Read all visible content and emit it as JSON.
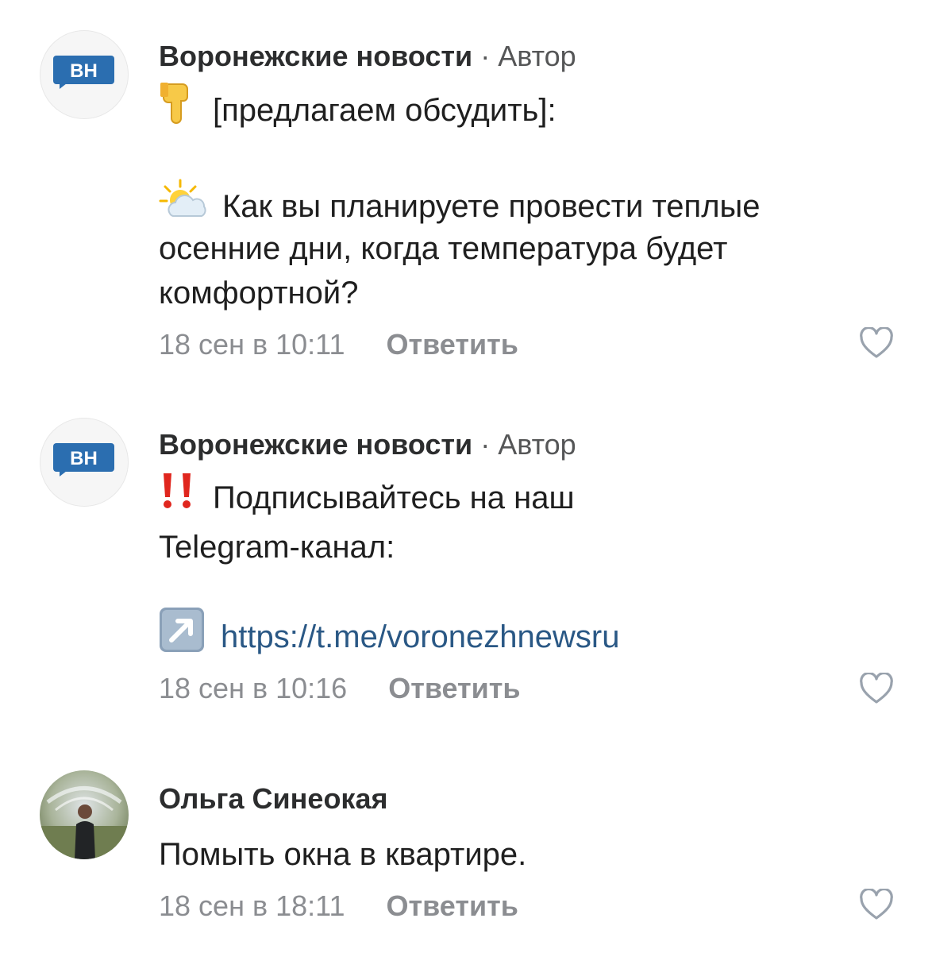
{
  "comments": [
    {
      "author": "Воронежские новости",
      "separator": "·",
      "role": "Автор",
      "avatar_text": "ВН",
      "line1": "[предлагаем обсудить]:",
      "line2": "Как вы планируете провести теплые",
      "line3": "осенние дни, когда температура будет",
      "line4": "комфортной?",
      "date": "18 сен в 10:11",
      "reply": "Ответить",
      "emoji_1": "backhand-index-pointing-down",
      "emoji_2": "sun-behind-cloud"
    },
    {
      "author": "Воронежские новости",
      "separator": "·",
      "role": "Автор",
      "avatar_text": "ВН",
      "line1": "Подписывайтесь на наш",
      "line2": "Telegram-канал:",
      "link": "https://t.me/voronezhnewsru",
      "date": "18 сен в 10:16",
      "reply": "Ответить",
      "emoji_1": "double-exclamation-mark",
      "emoji_2": "up-right-arrow"
    },
    {
      "author": "Ольга Синеокая",
      "line1": "Помыть окна в квартире.",
      "date": "18 сен в 18:11",
      "reply": "Ответить"
    }
  ],
  "colors": {
    "author": "#2c2d2e",
    "secondary": "#8b8d91",
    "link": "#2a5885",
    "brand_badge": "#2b6eb0",
    "heart": "#99a2ad"
  }
}
